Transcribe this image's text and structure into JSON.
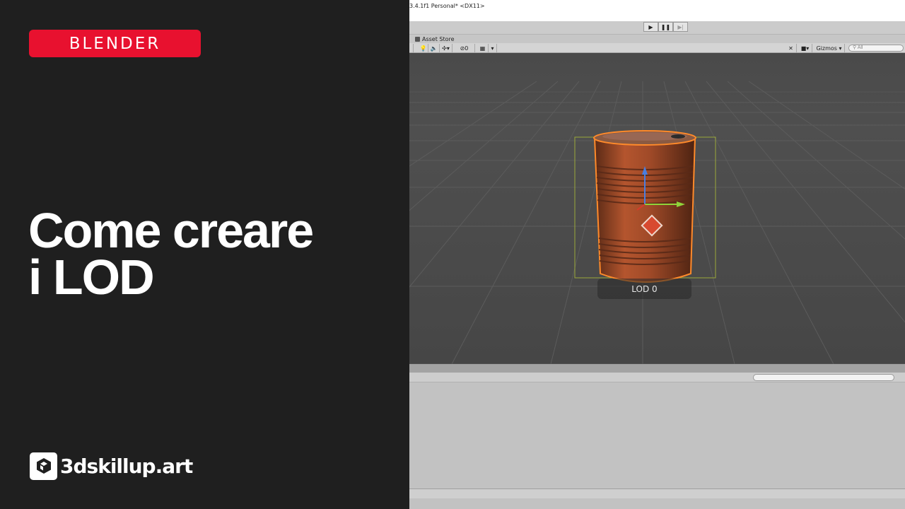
{
  "promo": {
    "category_badge": "BLENDER",
    "headline_line1": "Come creare",
    "headline_line2": "i LOD",
    "brand_name": "3dskillup.art",
    "brand_icon": "cube-icon",
    "badge_color": "#e8112f"
  },
  "editor": {
    "window_title": "3.4.1f1 Personal* <DX11>",
    "play_controls": [
      "play-icon",
      "pause-icon",
      "step-icon"
    ],
    "tab_label": "Asset Store",
    "scene_toolbar": {
      "effects_count": "0",
      "gizmos_label": "Gizmos",
      "search_placeholder": "All"
    },
    "viewport": {
      "selected_object": "barrel",
      "lod_label": "LOD 0"
    }
  }
}
